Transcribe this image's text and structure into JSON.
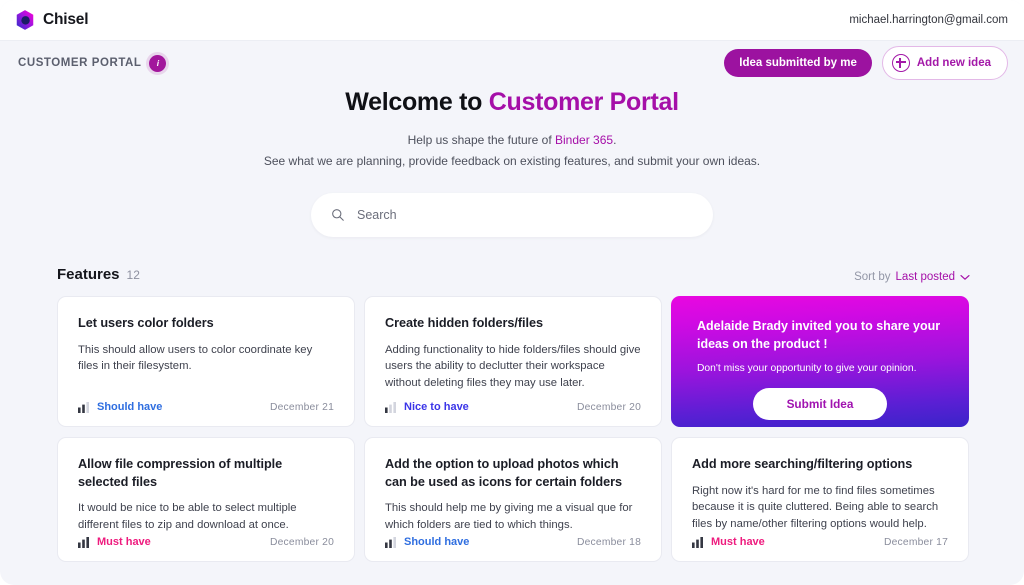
{
  "topbar": {
    "brand_name": "Chisel",
    "logo_icon": "hexagon-logo-icon",
    "user_email": "michael.harrington@gmail.com"
  },
  "header": {
    "portal_label": "CUSTOMER PORTAL",
    "info_badge": "i",
    "buttons": {
      "filter_label": "Idea submitted by me",
      "add_label": "Add new idea",
      "add_icon": "plus-circle-icon"
    }
  },
  "hero": {
    "title_prefix": "Welcome to ",
    "title_accent": "Customer Portal",
    "sub_line1_prefix": "Help us shape the future of ",
    "sub_line1_link": "Binder 365",
    "sub_line1_suffix": ".",
    "sub_line2": "See what we are planning, provide feedback on existing features, and submit your own ideas."
  },
  "search": {
    "placeholder": "Search",
    "icon": "search-icon"
  },
  "features": {
    "title": "Features",
    "count": "12",
    "sort_label": "Sort by",
    "sort_value": "Last posted",
    "sort_icon": "chevron-down-icon"
  },
  "cards": [
    {
      "title": "Let users color folders",
      "desc": "This should allow users to color coordinate key files in their filesystem.",
      "priority": "Should have",
      "priority_level": 2,
      "priority_color": "#2f6ee0",
      "date": "December 21"
    },
    {
      "title": "Create hidden folders/files",
      "desc": "Adding functionality to hide folders/files should give users the ability to declutter their workspace without deleting files they may use later.",
      "priority": "Nice to have",
      "priority_level": 1,
      "priority_color": "#3b35e8",
      "date": "December 20"
    },
    {
      "title": "Allow file compression of multiple selected files",
      "desc": "It would be nice to be able to select multiple different files to zip and download at once.",
      "priority": "Must have",
      "priority_level": 3,
      "priority_color": "#ee1b7e",
      "date": "December 20"
    },
    {
      "title": "Add the option to upload photos which can be used as icons for certain folders",
      "desc": "This should help me by giving me a visual que for which folders are tied to which things.",
      "priority": "Should have",
      "priority_level": 2,
      "priority_color": "#2f6ee0",
      "date": "December 18"
    },
    {
      "title": "Add more searching/filtering options",
      "desc": "Right now it's hard for me to find files sometimes because it is quite cluttered. Being able to search files by name/other filtering options would help.",
      "priority": "Must have",
      "priority_level": 3,
      "priority_color": "#ee1b7e",
      "date": "December 17"
    }
  ],
  "promo": {
    "title": "Adelaide Brady invited you to share your ideas on the product !",
    "subtitle": "Don't miss your opportunity to give your opinion.",
    "button_label": "Submit Idea"
  },
  "colors": {
    "brand_purple": "#a50fa8",
    "page_bg": "#f4f5fa"
  }
}
